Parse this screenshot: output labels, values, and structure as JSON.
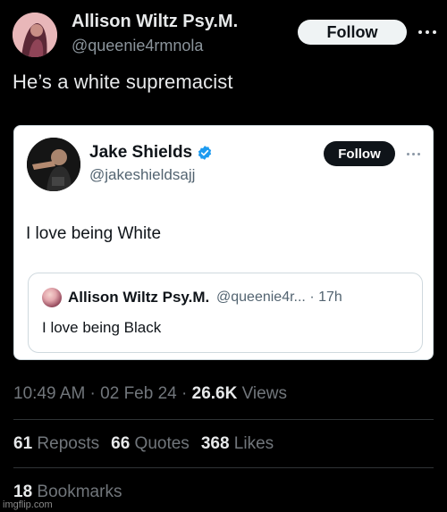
{
  "tweet": {
    "author_name": "Allison Wiltz Psy.M.",
    "author_handle": "@queenie4rmnola",
    "follow_label": "Follow",
    "text": "He’s a white supremacist",
    "timestamp": "10:49 AM · 02 Feb 24 · ",
    "views_count": "26.6K",
    "views_label": " Views",
    "stats": {
      "reposts_count": "61",
      "reposts_label": " Reposts",
      "quotes_count": "66",
      "quotes_label": " Quotes",
      "likes_count": "368",
      "likes_label": " Likes",
      "bookmarks_count": "18",
      "bookmarks_label": " Bookmarks"
    }
  },
  "embedded": {
    "author_name": "Jake Shields",
    "author_handle": "@jakeshieldsajj",
    "follow_label": "Follow",
    "text": "I love being White",
    "quote": {
      "author_name": "Allison Wiltz Psy.M.",
      "meta": "@queenie4r... · 17h",
      "text": "I love being Black"
    }
  },
  "watermark": "imgflip.com",
  "colors": {
    "background": "#000000",
    "text_primary": "#e7e9ea",
    "text_secondary": "#71767b",
    "card_background": "#ffffff",
    "verified_blue": "#1d9bf0"
  },
  "icons": [
    "more-options-icon",
    "verified-badge-icon"
  ]
}
